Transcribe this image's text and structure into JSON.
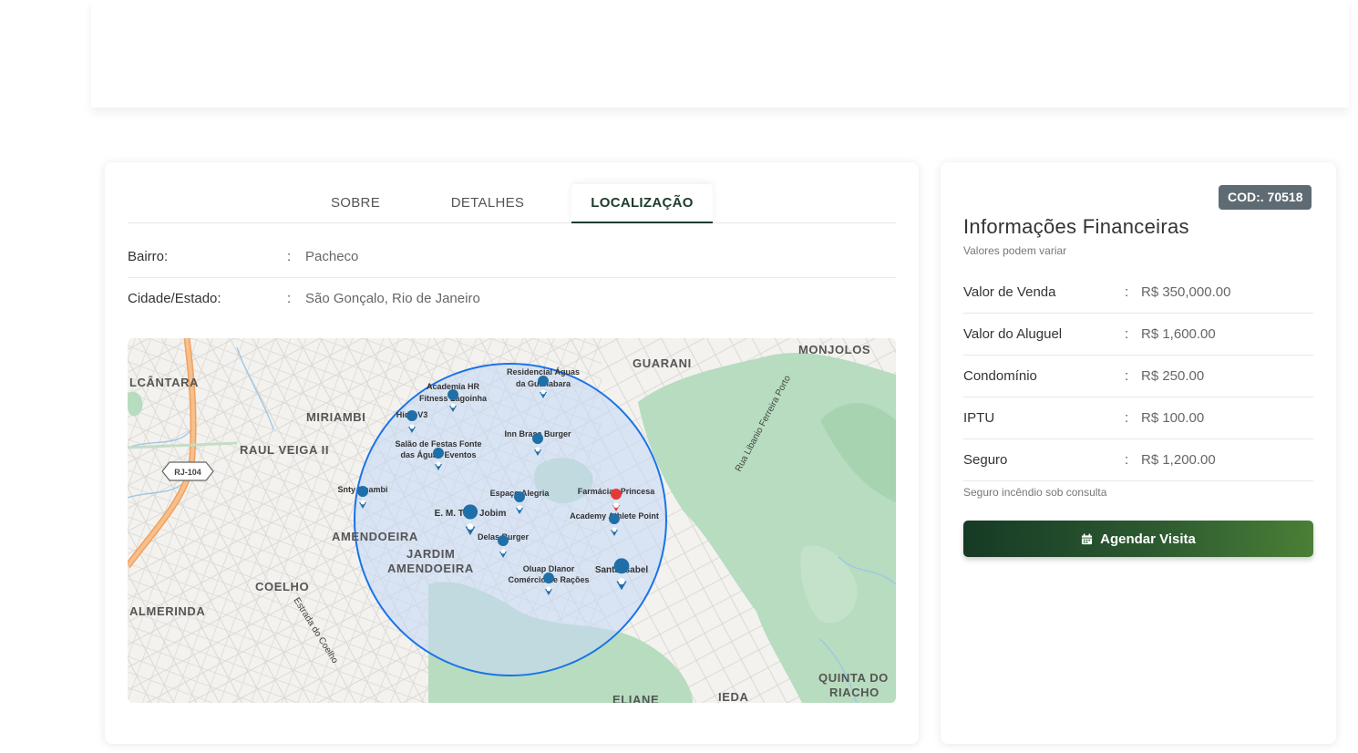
{
  "tabs": {
    "sobre": "SOBRE",
    "detalhes": "DETALHES",
    "localizacao": "LOCALIZAÇÃO",
    "active": "localizacao"
  },
  "location": {
    "rows": [
      {
        "label": "Bairro:",
        "colon": ":",
        "value": "Pacheco"
      },
      {
        "label": "Cidade/Estado:",
        "colon": ":",
        "value": "São Gonçalo, Rio de Janeiro"
      }
    ]
  },
  "map": {
    "area_labels": {
      "alcantara": "LCÂNTARA",
      "miriambi": "MIRIAMBI",
      "raul_veiga": "RAUL VEIGA II",
      "guarani": "GUARANI",
      "monjolos": "MONJOLOS",
      "amendoeira": "AMENDOEIRA",
      "jardim": "JARDIM",
      "jardim2": "AMENDOEIRA",
      "coelho": "COELHO",
      "almerinda": "ALMERINDA",
      "quinta1": "QUINTA DO",
      "quinta2": "RIACHO",
      "eliane": "ELIANE",
      "ieda": "IEDA"
    },
    "road_labels": {
      "rj104": "RJ-104",
      "estrada_coelho": "Estrada do Coelho",
      "rua_liberio": "Rua Libanio Ferreira Porto"
    },
    "pois": [
      {
        "key": "residencial1",
        "label": "Residencial Águas"
      },
      {
        "key": "residencial2",
        "label": "da Guanabara"
      },
      {
        "key": "academia1",
        "label": "Academia HR"
      },
      {
        "key": "academia2",
        "label": "Fitness Lagoinha"
      },
      {
        "key": "hidro",
        "label": "HidroV3"
      },
      {
        "key": "inn",
        "label": "Inn Brasa Burger"
      },
      {
        "key": "salao1",
        "label": "Salão de Festas Fonte"
      },
      {
        "key": "salao2",
        "label": "das Águas Eventos"
      },
      {
        "key": "snty",
        "label": "Snty Chambi"
      },
      {
        "key": "espaco",
        "label": "Espaço Alegria"
      },
      {
        "key": "farmacias",
        "label": "Farmácias Princesa"
      },
      {
        "key": "athlete",
        "label": "Academy Athlete Point"
      },
      {
        "key": "tom",
        "label": "E. M. Tom Jobim"
      },
      {
        "key": "delas",
        "label": "Delas Burger"
      },
      {
        "key": "oluap1",
        "label": "Oluap Dlanor"
      },
      {
        "key": "oluap2",
        "label": "Comércio de Rações"
      },
      {
        "key": "santa",
        "label": "Santa Isabel"
      }
    ],
    "colors": {
      "radius_stroke": "#1a73e8",
      "radius_fill": "#c6d9f5",
      "pin": "#1f6fa8",
      "pin_highlight": "#e53935",
      "green": "#b7dcbf"
    }
  },
  "finance": {
    "code_badge": "COD:. 70518",
    "title": "Informações Financeiras",
    "subtitle": "Valores podem variar",
    "rows": [
      {
        "label": "Valor de Venda",
        "colon": ":",
        "value": "R$ 350,000.00"
      },
      {
        "label": "Valor do Aluguel",
        "colon": ":",
        "value": "R$ 1,600.00"
      },
      {
        "label": "Condomínio",
        "colon": ":",
        "value": "R$ 250.00"
      },
      {
        "label": "IPTU",
        "colon": ":",
        "value": "R$ 100.00"
      },
      {
        "label": "Seguro",
        "colon": ":",
        "value": "R$ 1,200.00"
      }
    ],
    "note": "Seguro incêndio sob consulta",
    "button_label": "Agendar Visita",
    "button_icon": "calendar-icon"
  }
}
